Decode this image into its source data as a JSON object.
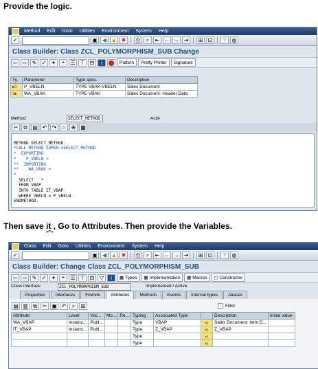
{
  "captions": {
    "first": "Provide the logic.",
    "second_pre": "Then save ",
    "second_word": "it ,",
    "second_post": "  Go to Attributes.  Then provide the Variables."
  },
  "menu": [
    "Method",
    "Edit",
    "Goto",
    "Utilities",
    "Environment",
    "System",
    "Help"
  ],
  "menu2": [
    "Class",
    "Edit",
    "Goto",
    "Utilities",
    "Environment",
    "System",
    "Help"
  ],
  "screen1": {
    "title": "Class Builder: Class ZCL_POLYMORPHISM_SUB Change",
    "buttons": {
      "pattern": "Pattern",
      "pretty_printer": "Pretty Printer",
      "signature": "Signature"
    },
    "params_headers": [
      "Ty.",
      "Parameter",
      "Type spec.",
      "Description"
    ],
    "params": [
      {
        "ty": "▸□",
        "name": "P_VBELN",
        "type": "TYPE VBAK-VBELN",
        "desc": "Sales Document"
      },
      {
        "ty": "□▸",
        "name": "WA_VBAK",
        "type": "TYPE VBAK",
        "desc": "Sales Document: Header Data"
      }
    ],
    "method_label": "Method",
    "method_name": "SELECT_METHOD",
    "status": "Activ",
    "code_lines": [
      "METHOD SELECT_METHOD.",
      "*CALL METHOD SUPER->SELECT_METHOD",
      "*  EXPORTING",
      "*    P_VBELN =",
      "**  IMPORTING",
      "**    WA_VBAK =",
      "*    .",
      "  SELECT   *",
      "  FROM VBAP",
      "  INTO TABLE IT_VBAP",
      "  WHERE VBELN = P_VBELN.",
      "ENDMETHOD."
    ]
  },
  "screen2": {
    "title": "Class Builder: Change Class ZCL_POLYMORPHISM_SUB",
    "buttons": {
      "types": "Types",
      "implementation": "Implementation",
      "macros": "Macros",
      "constructor": "Constructor"
    },
    "class_interface_label": "Class interface",
    "class_interface_value": "ZCL_POLYMORPHISM_SUB",
    "class_status": "Implemented / Active",
    "tabs": [
      "Properties",
      "Interfaces",
      "Friends",
      "Attributes",
      "Methods",
      "Events",
      "Internal types",
      "Aliases"
    ],
    "active_tab": "Attributes",
    "filter_label": "Filter",
    "attr_headers": [
      "Attribute",
      "Level",
      "Visi...",
      "Mo...",
      "Re...",
      "Typing",
      "Associated Type",
      "",
      "Description",
      "Initial value"
    ],
    "attributes": [
      {
        "name": "WA_VBAP",
        "level": "Instanc...",
        "vis": "Publ...",
        "typing": "Type",
        "assoc": "VBAP",
        "desc": "Sales Document: Item D..."
      },
      {
        "name": "IT_VBAP",
        "level": "Instanc...",
        "vis": "Publ...",
        "typing": "Type",
        "assoc": "Z_VBAP",
        "desc": "Z_VBAP"
      },
      {
        "name": "",
        "level": "",
        "vis": "",
        "typing": "Type",
        "assoc": "",
        "desc": ""
      },
      {
        "name": "",
        "level": "",
        "vis": "",
        "typing": "Type",
        "assoc": "",
        "desc": ""
      }
    ]
  }
}
